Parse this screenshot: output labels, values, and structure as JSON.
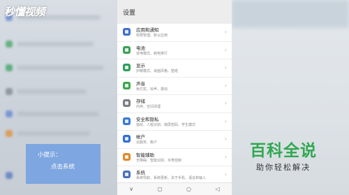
{
  "watermark": "秒懂视频",
  "hint": {
    "title": "小提示：",
    "body": "点击系统"
  },
  "phone": {
    "title": "设置",
    "items": [
      {
        "title": "应用和通知",
        "sub": "权限管理、默认应用",
        "color": "#3f6fd0",
        "icon": "apps-icon"
      },
      {
        "title": "电池",
        "sub": "省电模式、耗电排行",
        "color": "#3aa157",
        "icon": "battery-icon"
      },
      {
        "title": "显示",
        "sub": "护眼模式、桌面风格、壁纸",
        "color": "#2e9e5a",
        "icon": "display-icon"
      },
      {
        "title": "声音",
        "sub": "免打扰、铃声、振动",
        "color": "#3fa64f",
        "icon": "sound-icon"
      },
      {
        "title": "存储",
        "sub": "内存、空间清理",
        "color": "#7a7f86",
        "icon": "storage-icon"
      },
      {
        "title": "安全和隐私",
        "sub": "指纹、人脸识别、锁屏密码、学生模式",
        "color": "#3a78d8",
        "icon": "security-icon"
      },
      {
        "title": "帐户",
        "sub": "云服务、帐户",
        "color": "#2f6fd4",
        "icon": "account-icon"
      },
      {
        "title": "智能辅助",
        "sub": "无障碍、智能识别、手势控制",
        "color": "#e08a2b",
        "icon": "assist-icon"
      },
      {
        "title": "系统",
        "sub": "系统导航、系统更新、关于手机、语言和输入",
        "color": "#4a6fbf",
        "icon": "system-icon"
      }
    ],
    "nav": [
      "∨",
      "◻",
      "○",
      "◁"
    ]
  },
  "logo": {
    "main": "百科全说",
    "sub": "助你轻松解决"
  }
}
